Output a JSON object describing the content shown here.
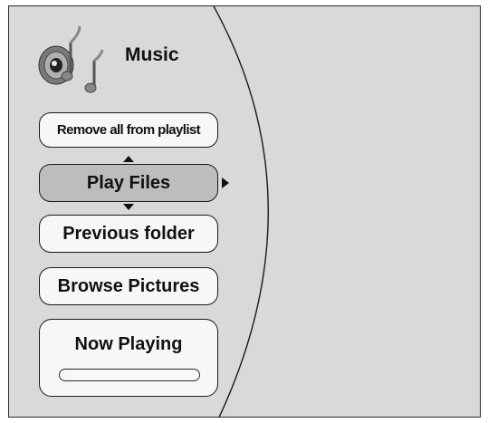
{
  "screen": {
    "title": "Music",
    "icon": "music-notes-speaker-icon"
  },
  "menu": {
    "items": [
      {
        "label": "Remove all from playlist",
        "selected": false
      },
      {
        "label": "Play Files",
        "selected": true
      },
      {
        "label": "Previous folder",
        "selected": false
      },
      {
        "label": "Browse Pictures",
        "selected": false
      }
    ]
  },
  "now_playing": {
    "label": "Now Playing",
    "progress": 0
  },
  "colors": {
    "background": "#d9d9d9",
    "button": "#f7f7f7",
    "selected_button": "#bdbdbd",
    "outline": "#1a1a1a"
  }
}
